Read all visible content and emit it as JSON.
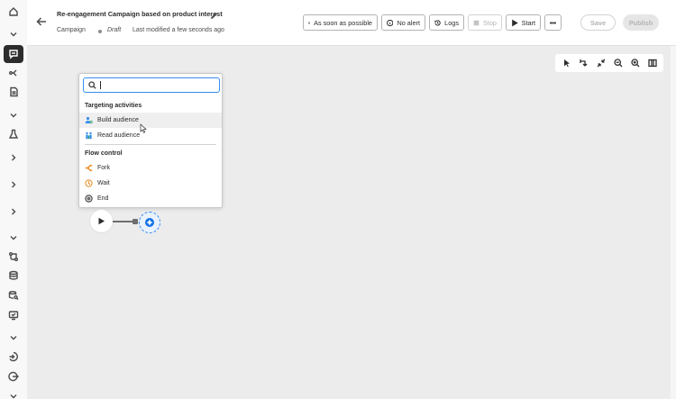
{
  "header": {
    "title": "Re-engagement Campaign based on product interest",
    "type": "Campaign",
    "status": "Draft",
    "modified": "Last modified a few seconds ago"
  },
  "toolbar": {
    "schedule_label": "As soon as possible",
    "alert_label": "No alert",
    "logs_label": "Logs",
    "stop_label": "Stop",
    "start_label": "Start",
    "save_label": "Save",
    "publish_label": "Publish"
  },
  "activity_menu": {
    "search_placeholder": "",
    "sections": [
      {
        "title": "Targeting activities",
        "items": [
          {
            "label": "Build audience",
            "icon": "build-audience-icon"
          },
          {
            "label": "Read audience",
            "icon": "read-audience-icon"
          }
        ]
      },
      {
        "title": "Flow control",
        "items": [
          {
            "label": "Fork",
            "icon": "fork-icon"
          },
          {
            "label": "Wait",
            "icon": "wait-icon"
          },
          {
            "label": "End",
            "icon": "end-icon"
          }
        ]
      }
    ]
  },
  "colors": {
    "accent": "#1473e6",
    "fork": "#e68619",
    "wait": "#e68619",
    "audience": "#2d9d78"
  }
}
